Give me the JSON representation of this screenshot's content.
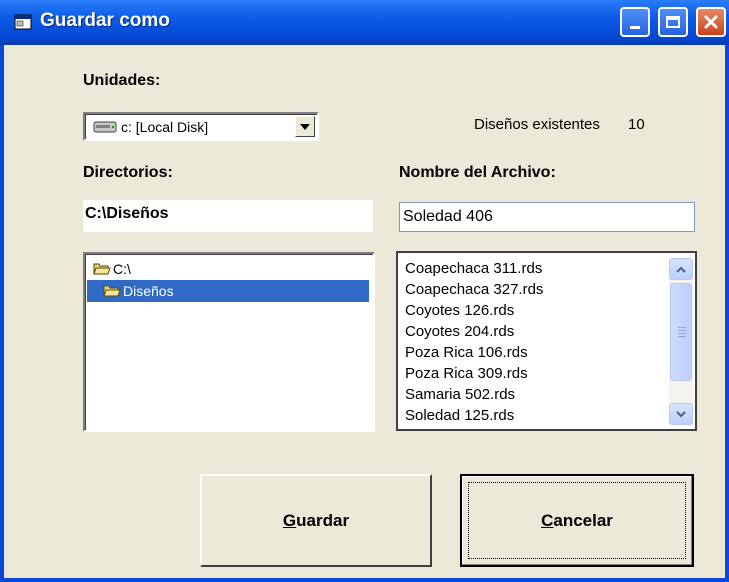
{
  "window": {
    "title": "Guardar como"
  },
  "drives": {
    "label": "Unidades:",
    "selected_prefix": "c:",
    "selected_rest": "[Local Disk]"
  },
  "existing": {
    "label": "Diseños existentes",
    "count": "10"
  },
  "directories": {
    "label": "Directorios:",
    "current_path": "C:\\Diseños",
    "items": [
      {
        "label": "C:\\",
        "selected": false
      },
      {
        "label": "Diseños",
        "selected": true
      }
    ]
  },
  "filename": {
    "label": "Nombre del Archivo:",
    "value": "Soledad 406"
  },
  "files": {
    "items": [
      "Coapechaca 311.rds",
      "Coapechaca 327.rds",
      "Coyotes 126.rds",
      "Coyotes 204.rds",
      "Poza Rica 106.rds",
      "Poza Rica 309.rds",
      "Samaria 502.rds",
      "Soledad 125.rds"
    ]
  },
  "buttons": {
    "save_first": "G",
    "save_rest": "uardar",
    "cancel_first": "C",
    "cancel_rest": "ancelar"
  },
  "colors": {
    "titlebar": "#0a5ce8",
    "selection": "#316ac5",
    "face": "#ece9d8"
  }
}
